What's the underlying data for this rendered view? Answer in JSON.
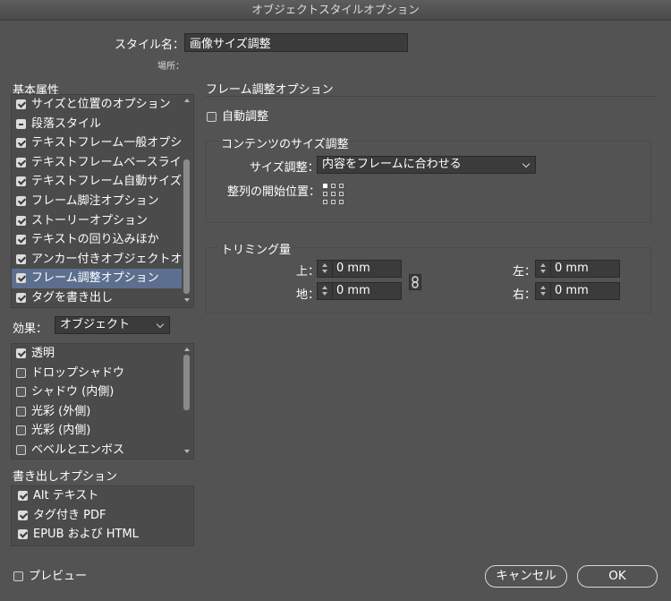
{
  "window": {
    "title": "オブジェクトスタイルオプション"
  },
  "style_name": {
    "label": "スタイル名：",
    "value": "画像サイズ調整"
  },
  "location": {
    "label": "場所："
  },
  "basic_attributes": {
    "header": "基本属性",
    "items": [
      {
        "label": "サイズと位置のオプション",
        "state": "checked"
      },
      {
        "label": "段落スタイル",
        "state": "mixed"
      },
      {
        "label": "テキストフレーム一般オプション",
        "state": "checked"
      },
      {
        "label": "テキストフレームベースラインオプション",
        "state": "checked"
      },
      {
        "label": "テキストフレーム自動サイズ調整オプション",
        "state": "checked"
      },
      {
        "label": "フレーム脚注オプション",
        "state": "checked"
      },
      {
        "label": "ストーリーオプション",
        "state": "checked"
      },
      {
        "label": "テキストの回り込みほか",
        "state": "checked"
      },
      {
        "label": "アンカー付きオブジェクトオプション",
        "state": "checked"
      },
      {
        "label": "フレーム調整オプション",
        "state": "checked",
        "selected": true
      },
      {
        "label": "タグを書き出し",
        "state": "checked"
      }
    ]
  },
  "effects": {
    "label": "効果：",
    "selected": "オブジェクト",
    "items": [
      {
        "label": "透明",
        "state": "checked"
      },
      {
        "label": "ドロップシャドウ",
        "state": "unchecked"
      },
      {
        "label": "シャドウ (内側)",
        "state": "unchecked"
      },
      {
        "label": "光彩 (外側)",
        "state": "unchecked"
      },
      {
        "label": "光彩 (内側)",
        "state": "unchecked"
      },
      {
        "label": "ベベルとエンボス",
        "state": "unchecked"
      }
    ]
  },
  "export_options": {
    "header": "書き出しオプション",
    "items": [
      {
        "label": "Alt テキスト",
        "state": "checked"
      },
      {
        "label": "タグ付き PDF",
        "state": "checked"
      },
      {
        "label": "EPUB および HTML",
        "state": "checked"
      }
    ]
  },
  "preview": {
    "label": "プレビュー",
    "state": "unchecked"
  },
  "panel": {
    "title": "フレーム調整オプション",
    "auto_fit": {
      "label": "自動調整",
      "state": "unchecked"
    },
    "content_fitting": {
      "header": "コンテンツのサイズ調整",
      "fitting_label": "サイズ調整：",
      "fitting_value": "内容をフレームに合わせる",
      "align_label": "整列の開始位置："
    },
    "crop_amount": {
      "header": "トリミング量",
      "top_label": "上：",
      "top_value": "0 mm",
      "bottom_label": "地：",
      "bottom_value": "0 mm",
      "left_label": "左：",
      "left_value": "0 mm",
      "right_label": "右：",
      "right_value": "0 mm"
    }
  },
  "buttons": {
    "cancel": "キャンセル",
    "ok": "OK"
  }
}
